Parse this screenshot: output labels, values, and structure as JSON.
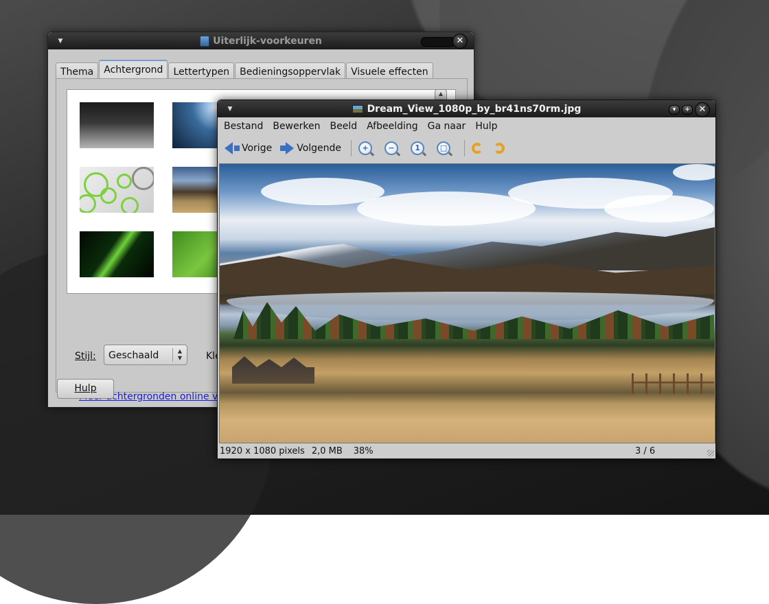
{
  "prefs": {
    "title": "Uiterlijk-voorkeuren",
    "tabs": [
      "Thema",
      "Achtergrond",
      "Lettertypen",
      "Bedieningsoppervlak",
      "Visuele effecten"
    ],
    "active_tab": "Achtergrond",
    "style_label": "Stijl:",
    "style_value": "Geschaald",
    "color_label": "Kleu",
    "online_link": "Meer achtergronden online verkrijgen",
    "help_button": "Hulp"
  },
  "viewer": {
    "title": "Dream_View_1080p_by_br41ns70rm.jpg",
    "menu": [
      "Bestand",
      "Bewerken",
      "Beeld",
      "Afbeelding",
      "Ga naar",
      "Hulp"
    ],
    "toolbar": {
      "prev": "Vorige",
      "next": "Volgende",
      "icons": [
        "zoom-in-icon",
        "zoom-out-icon",
        "zoom-normal-icon",
        "zoom-fit-icon",
        "rotate-left-icon",
        "rotate-right-icon"
      ]
    },
    "status": {
      "dimensions": "1920 x 1080 pixels",
      "filesize": "2,0 MB",
      "zoom": "38%",
      "position": "3 / 6"
    },
    "window_buttons": [
      "▾",
      "+",
      "✕"
    ]
  },
  "colors": {
    "accent_tab": "#6f9fd6",
    "link": "#1b1bd8",
    "nav_arrow": "#3b6fc2",
    "rotate": "#e8a020"
  }
}
